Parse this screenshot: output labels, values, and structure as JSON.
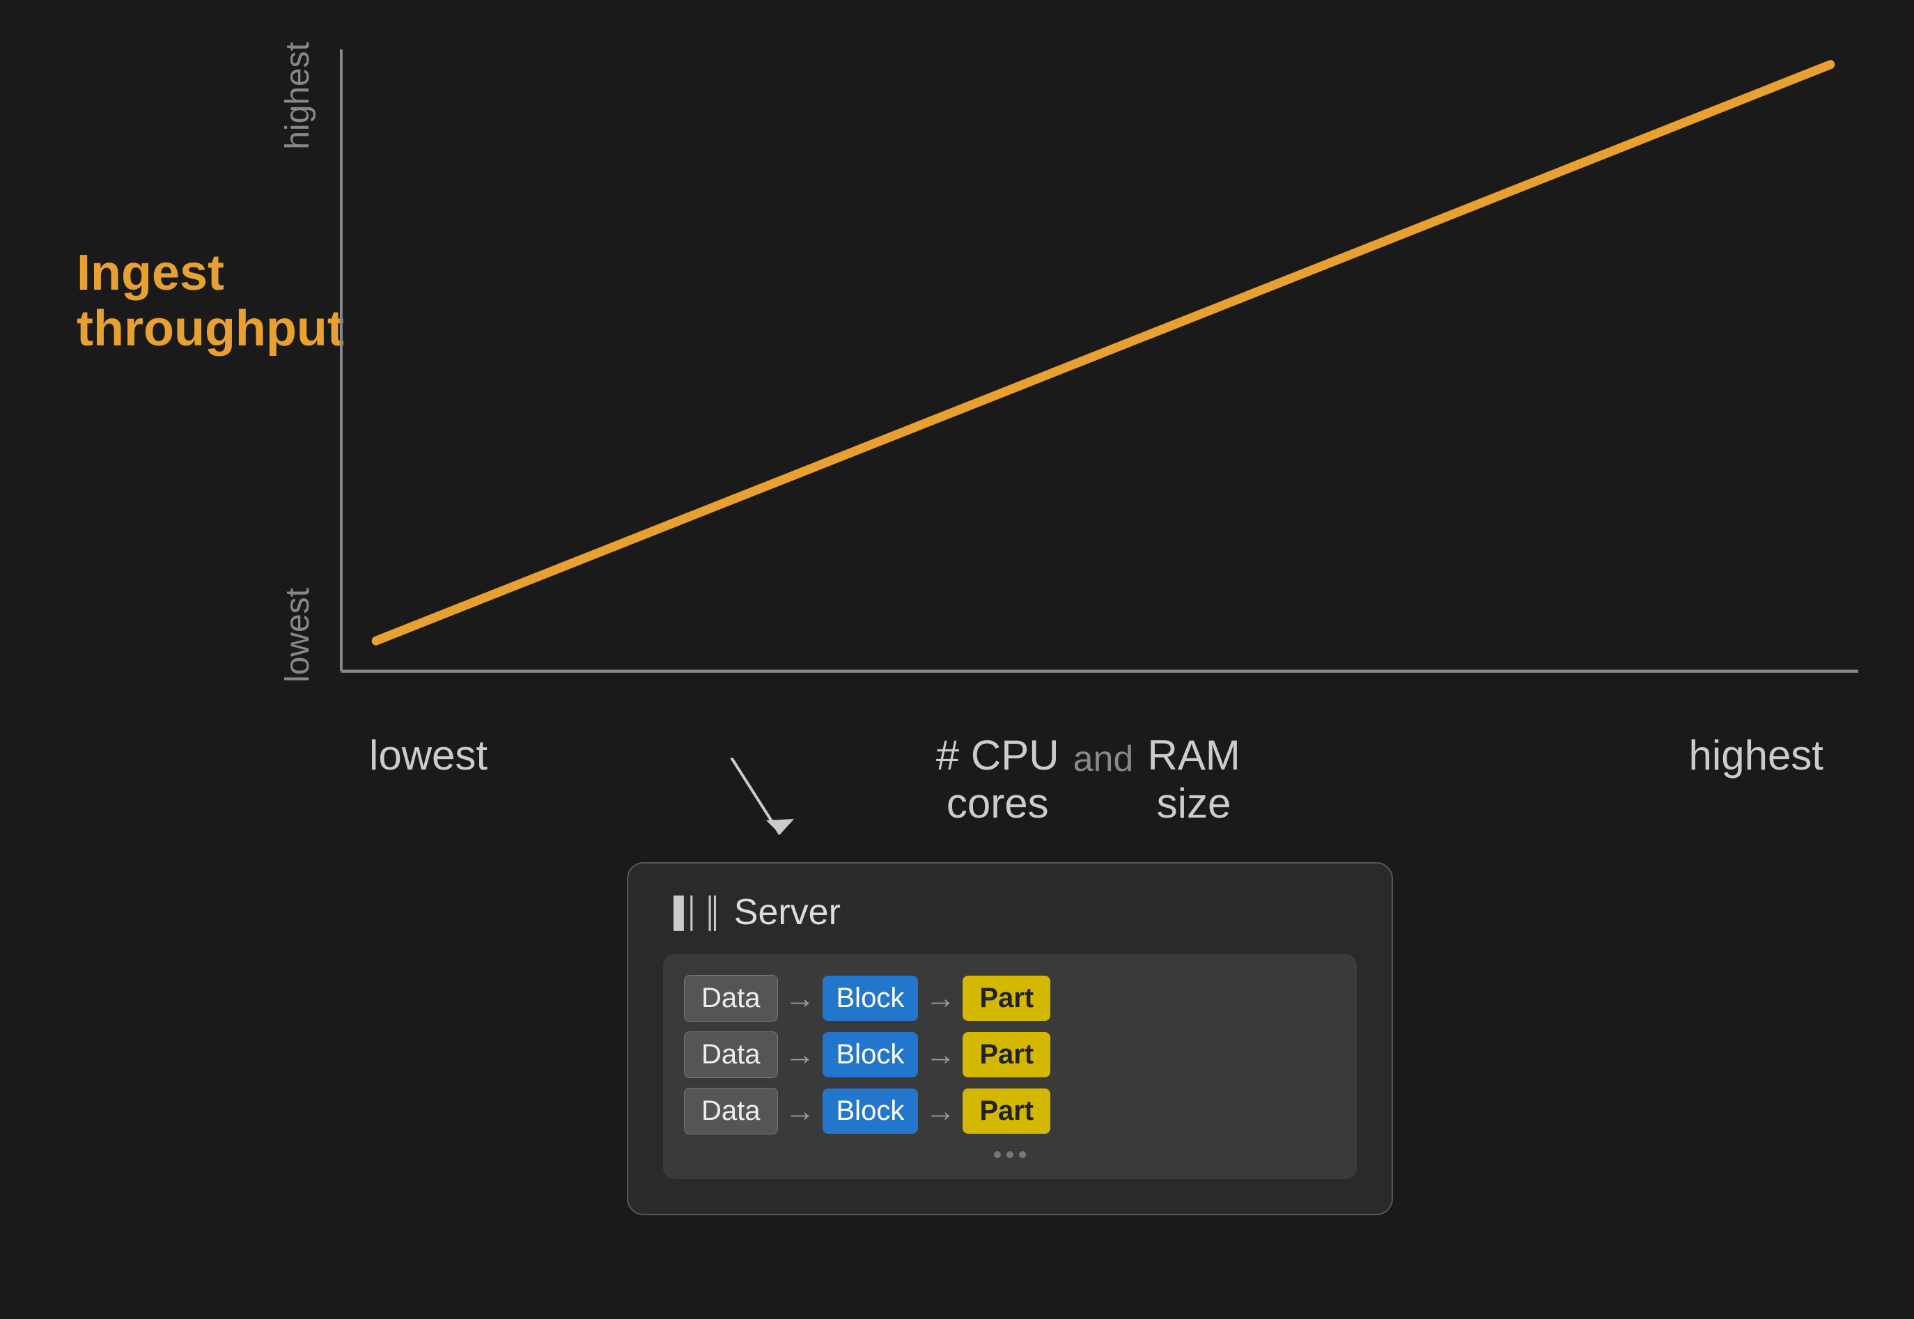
{
  "chart": {
    "y_label_line1": "Ingest",
    "y_label_line2": "throughput",
    "y_highest": "highest",
    "y_lowest": "lowest",
    "y_label_color": "#E8A030",
    "line_color": "#E8A030"
  },
  "x_axis": {
    "lowest": "lowest",
    "cpu_cores_line1": "# CPU",
    "cpu_cores_line2": "cores",
    "and": "and",
    "ram_line1": "RAM",
    "ram_line2": "size",
    "highest": "highest"
  },
  "diagram": {
    "server_label": "Server",
    "rows": [
      {
        "data": "Data",
        "block": "Block",
        "part": "Part"
      },
      {
        "data": "Data",
        "block": "Block",
        "part": "Part"
      },
      {
        "data": "Data",
        "block": "Block",
        "part": "Part"
      }
    ],
    "dots": [
      "•",
      "•",
      "•"
    ]
  }
}
